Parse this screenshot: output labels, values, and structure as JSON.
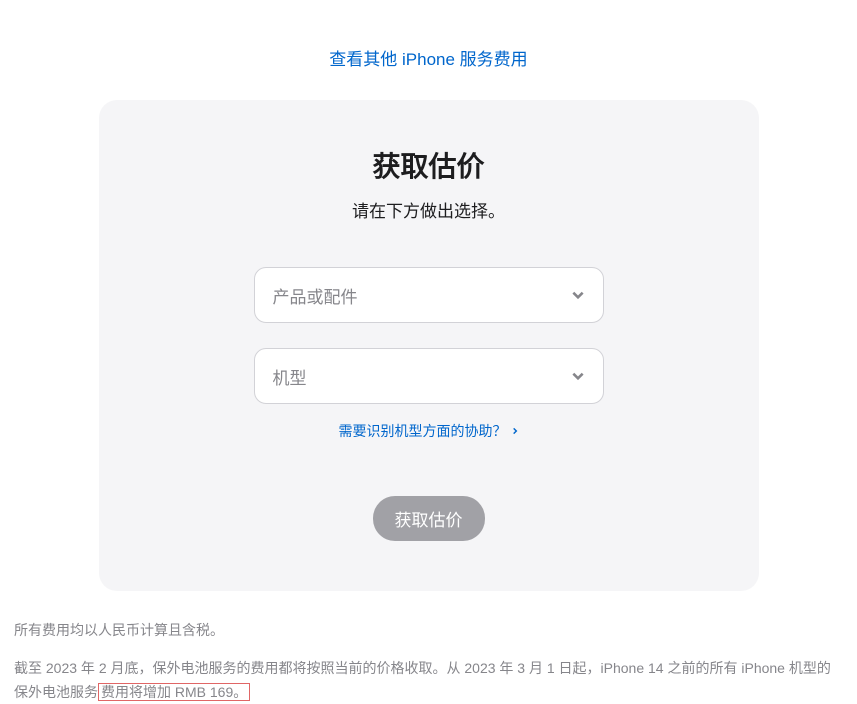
{
  "topLink": "查看其他 iPhone 服务费用",
  "card": {
    "title": "获取估价",
    "subtitle": "请在下方做出选择。",
    "select1": {
      "placeholder": "产品或配件"
    },
    "select2": {
      "placeholder": "机型"
    },
    "helpLink": "需要识别机型方面的协助？",
    "button": "获取估价"
  },
  "footer": {
    "line1": "所有费用均以人民币计算且含税。",
    "line2_part1": "截至 2023 年 2 月底，保外电池服务的费用都将按照当前的价格收取。从 2023 年 3 月 1 日起，iPhone 14 之前的所有 iPhone 机型的保外电池服务",
    "line2_highlight": "费用将增加 RMB 169。"
  }
}
